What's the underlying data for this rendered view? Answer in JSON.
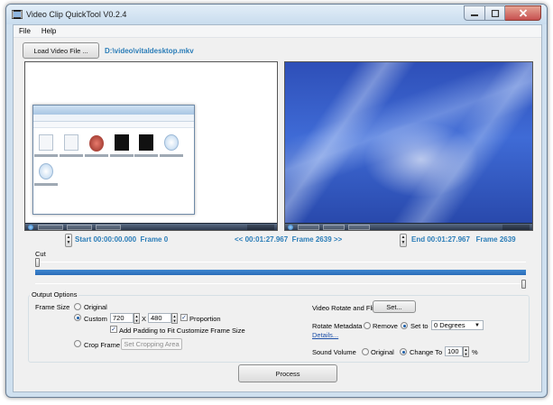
{
  "window": {
    "title": "Video Clip QuickTool V0.2.4",
    "controls": [
      "minimize",
      "maximize",
      "close"
    ]
  },
  "menu": [
    "File",
    "Help"
  ],
  "toolbar": {
    "load_button": "Load Video File ...",
    "file_path": "D:\\video\\vitaldesktop.mkv"
  },
  "navigation": {
    "start": "Start 00:00:00.000  Frame 0",
    "duration": "<< 00:01:27.967  Frame 2639 >>",
    "end": "End 00:01:27.967   Frame 2639"
  },
  "cut": {
    "label": "Cut",
    "start_fraction": 0.0,
    "end_fraction": 1.0
  },
  "output_options": {
    "title": "Output Options",
    "frame_size": {
      "label": "Frame Size",
      "original_label": "Original",
      "custom_label": "Custom",
      "width": "720",
      "x_label": "X",
      "height": "480",
      "proportion_label": "Proportion",
      "proportion_checked": true,
      "padding_label": "Add Padding to Fit Customize Frame Size",
      "padding_checked": true,
      "selected": "Custom"
    },
    "crop": {
      "label": "Crop Frame",
      "button": "Set Cropping Area",
      "selected": false
    },
    "rotate": {
      "label": "Video Rotate and Flip",
      "button": "Set..."
    },
    "metadata": {
      "label": "Rotate Metadata",
      "remove_label": "Remove",
      "set_to_label": "Set to",
      "selected": "Set to",
      "value": "0 Degrees",
      "details_link": "Details..."
    },
    "sound": {
      "label": "Sound Volume",
      "original_label": "Original",
      "change_label": "Change To",
      "selected": "Change To",
      "value": "100",
      "unit": "%"
    }
  },
  "process_button": "Process",
  "colors": {
    "accent_text": "#2b7db8",
    "range_bar": "#2a6cb8",
    "window_frame": "#cfe0ef"
  }
}
